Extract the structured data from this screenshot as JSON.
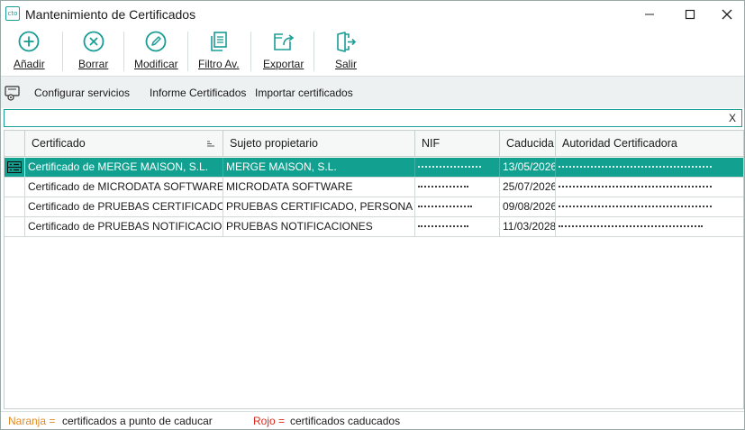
{
  "window": {
    "title": "Mantenimiento de Certificados",
    "app_icon_text": "cto",
    "minimize": "—",
    "maximize": "☐",
    "close": "✕"
  },
  "toolbar": {
    "add_label": "Añadir",
    "delete_label": "Borrar",
    "edit_label": "Modificar",
    "filter_label": "Filtro Av.",
    "export_label": "Exportar",
    "exit_label": "Salir"
  },
  "secondary": {
    "configure_label": "Configurar servicios",
    "report_label": "Informe Certificados",
    "import_label": "Importar certificados"
  },
  "search": {
    "value": "",
    "clear_label": "X"
  },
  "table": {
    "columns": [
      "Certificado",
      "Sujeto propietario",
      "NIF",
      "Caducida",
      "Autoridad Certificadora"
    ],
    "rows": [
      {
        "certificado": "Certificado de MERGE MAISON, S.L.",
        "sujeto": "MERGE MAISON, S.L.",
        "caducidad": "13/05/2026",
        "selected": true
      },
      {
        "certificado": "Certificado de MICRODATA SOFTWARE",
        "sujeto": "MICRODATA SOFTWARE",
        "caducidad": "25/07/2026",
        "selected": false
      },
      {
        "certificado": "Certificado de PRUEBAS CERTIFICADO, P",
        "sujeto": "PRUEBAS CERTIFICADO, PERSONA F",
        "caducidad": "09/08/2026",
        "selected": false
      },
      {
        "certificado": "Certificado de PRUEBAS NOTIFICACIONE",
        "sujeto": "PRUEBAS NOTIFICACIONES",
        "caducidad": "11/03/2028",
        "selected": false
      }
    ]
  },
  "legend": {
    "orange_key": "Naranja =",
    "orange_text": "certificados a punto de caducar",
    "red_key": "Rojo =",
    "red_text": "certificados caducados"
  },
  "colors": {
    "accent": "#12a191",
    "orange": "#e08a1e",
    "red": "#d62b20"
  }
}
